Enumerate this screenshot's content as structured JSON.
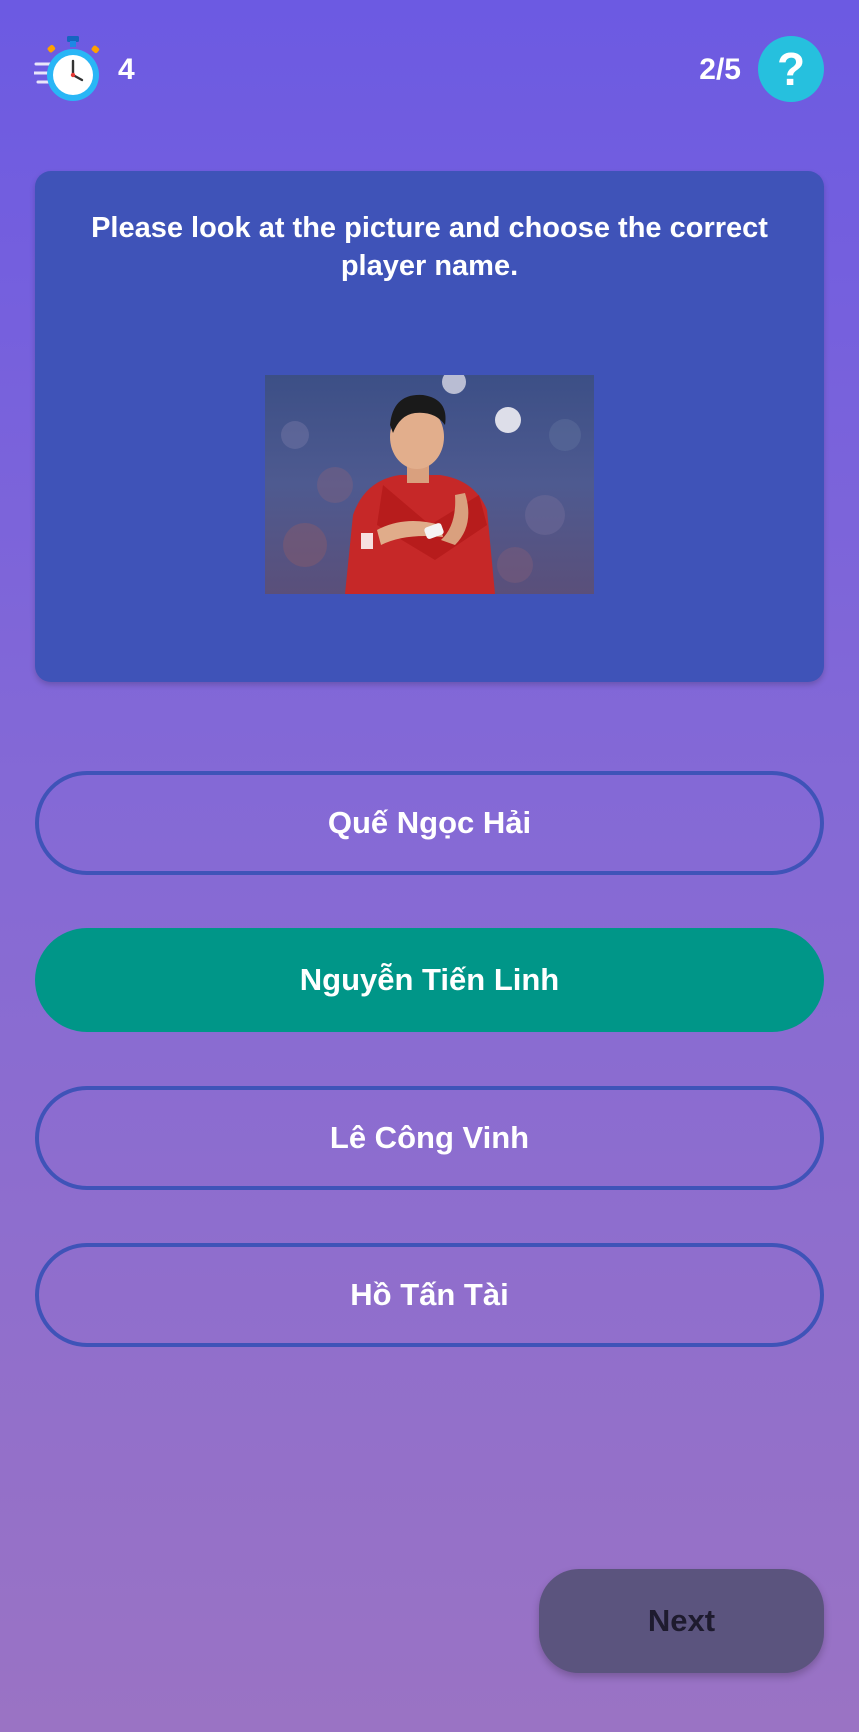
{
  "header": {
    "timer_icon": "stopwatch-icon",
    "timer_value": "4",
    "progress": "2/5",
    "help_label": "?"
  },
  "question": {
    "text": "Please look at the picture and choose the correct player name.",
    "image": "player-photo"
  },
  "options": [
    {
      "label": "Quế Ngọc Hải",
      "selected": false
    },
    {
      "label": "Nguyễn Tiến Linh",
      "selected": true
    },
    {
      "label": "Lê Công Vinh",
      "selected": false
    },
    {
      "label": "Hồ Tấn Tài",
      "selected": false
    }
  ],
  "footer": {
    "next_label": "Next"
  },
  "colors": {
    "background_top": "#6c5ae2",
    "background_bottom": "#9a73c4",
    "card": "#3f53b8",
    "selected_option": "#009688",
    "help_button": "#26c0de",
    "next_button": "#5b547e"
  }
}
